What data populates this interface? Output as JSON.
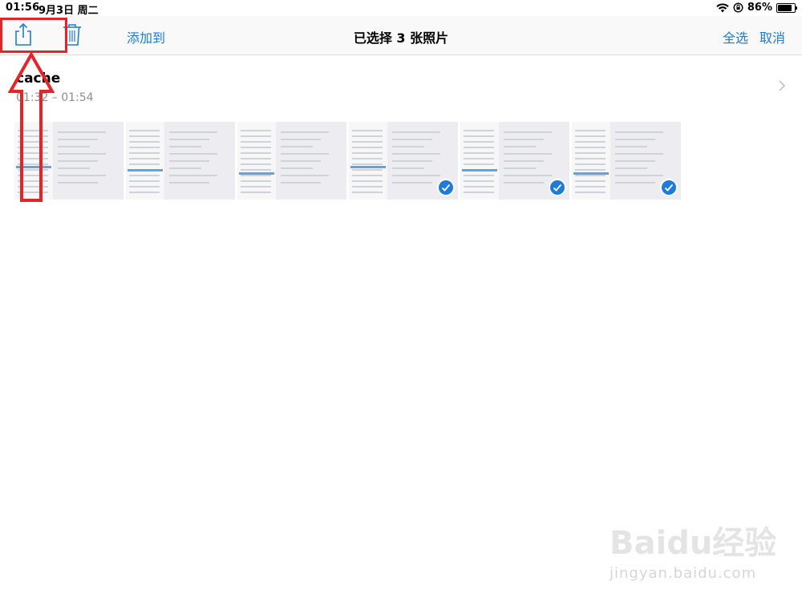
{
  "status_bar": {
    "time": "01:56",
    "date": "9月3日 周二",
    "battery_percent": "86%",
    "battery_level": 0.86
  },
  "nav": {
    "add_to_label": "添加到",
    "title": "已选择 3 张照片",
    "select_all_label": "全选",
    "cancel_label": "取消",
    "accent_color": "#1e7bd7"
  },
  "album": {
    "title": "cache",
    "time_range": "01:32 – 01:54"
  },
  "photos": [
    {
      "selected": false
    },
    {
      "selected": false
    },
    {
      "selected": false
    },
    {
      "selected": true
    },
    {
      "selected": true
    },
    {
      "selected": true
    }
  ],
  "annotation": {
    "color": "#e5242a",
    "shapes": [
      "highlight-box",
      "up-arrow"
    ]
  },
  "watermark": {
    "logo": "Baidu经验",
    "url": "jingyan.baidu.com"
  },
  "icons": [
    "share-icon",
    "trash-icon",
    "chevron-right-icon",
    "wifi-icon",
    "lock-rotation-icon",
    "battery-icon",
    "checkmark-icon"
  ]
}
